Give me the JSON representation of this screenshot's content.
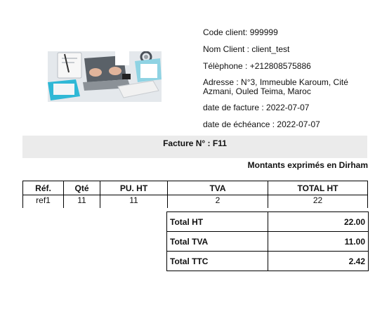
{
  "client": {
    "code": "Code client: 999999",
    "name": "Nom Client : client_test",
    "phone": "Télèphone : +212808575886",
    "address": "Adresse : N°3, Immeuble Karoum, Cité Azmani, Ouled Teima, Maroc",
    "invoice_date": "date de facture : 2022-07-07",
    "due_date": "date de échéance : 2022-07-07"
  },
  "invoice": {
    "title": "Facture N° : F11",
    "currency_note": "Montants exprimés en Dirham"
  },
  "items_table": {
    "headers": [
      "Réf.",
      "Qté",
      "PU. HT",
      "TVA",
      "TOTAL HT"
    ],
    "rows": [
      [
        "ref1",
        "11",
        "11",
        "2",
        "22"
      ]
    ]
  },
  "totals": [
    {
      "label": "Total HT",
      "value": "22.00"
    },
    {
      "label": "Total TVA",
      "value": "11.00"
    },
    {
      "label": "Total TTC",
      "value": "2.42"
    }
  ],
  "colors": {
    "bar_background": "#ebebeb",
    "border": "#000000"
  }
}
